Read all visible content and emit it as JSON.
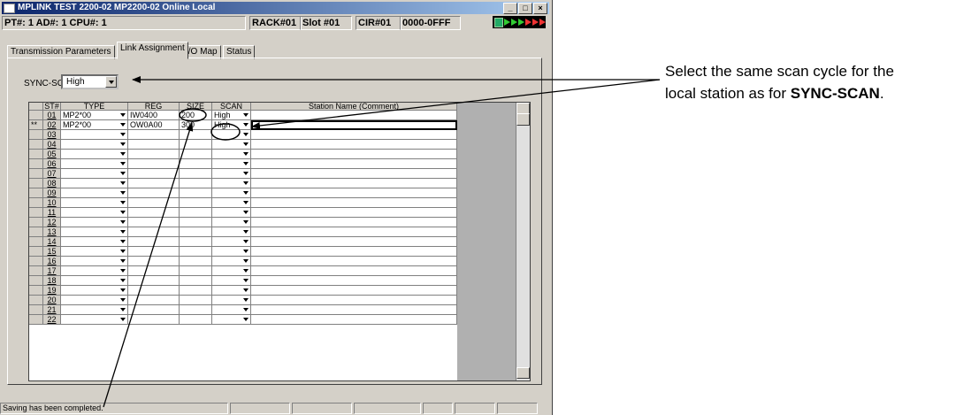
{
  "window": {
    "title": "MPLINK  TEST 2200-02 MP2200-02 Online Local",
    "minimize": "_",
    "maximize": "□",
    "close": "×"
  },
  "infobar": {
    "location": "PT#: 1 AD#: 1 CPU#: 1",
    "rack": "RACK#01",
    "slot": "Slot #01",
    "cir": "CIR#01",
    "range": "0000-0FFF"
  },
  "tabs": [
    "Transmission Parameters",
    "Link Assignment",
    "I/O Map",
    "Status"
  ],
  "sync_scan": {
    "label": "SYNC-SCAN",
    "value": "High"
  },
  "table": {
    "headers": {
      "st": "ST#",
      "type": "TYPE",
      "reg": "REG",
      "size": "SIZE",
      "scan": "SCAN",
      "name": "Station Name (Comment)"
    },
    "rows": [
      {
        "mark": "",
        "st": "01",
        "type": "MP2*00",
        "reg": "IW0400",
        "size": "200",
        "scan": "High",
        "name": ""
      },
      {
        "mark": "**",
        "st": "02",
        "type": "MP2*00",
        "reg": "OW0A00",
        "size": "300",
        "scan": "High",
        "name": ""
      },
      {
        "mark": "",
        "st": "03",
        "type": "",
        "reg": "",
        "size": "",
        "scan": "",
        "name": ""
      },
      {
        "mark": "",
        "st": "04",
        "type": "",
        "reg": "",
        "size": "",
        "scan": "",
        "name": ""
      },
      {
        "mark": "",
        "st": "05",
        "type": "",
        "reg": "",
        "size": "",
        "scan": "",
        "name": ""
      },
      {
        "mark": "",
        "st": "06",
        "type": "",
        "reg": "",
        "size": "",
        "scan": "",
        "name": ""
      },
      {
        "mark": "",
        "st": "07",
        "type": "",
        "reg": "",
        "size": "",
        "scan": "",
        "name": ""
      },
      {
        "mark": "",
        "st": "08",
        "type": "",
        "reg": "",
        "size": "",
        "scan": "",
        "name": ""
      },
      {
        "mark": "",
        "st": "09",
        "type": "",
        "reg": "",
        "size": "",
        "scan": "",
        "name": ""
      },
      {
        "mark": "",
        "st": "10",
        "type": "",
        "reg": "",
        "size": "",
        "scan": "",
        "name": ""
      },
      {
        "mark": "",
        "st": "11",
        "type": "",
        "reg": "",
        "size": "",
        "scan": "",
        "name": ""
      },
      {
        "mark": "",
        "st": "12",
        "type": "",
        "reg": "",
        "size": "",
        "scan": "",
        "name": ""
      },
      {
        "mark": "",
        "st": "13",
        "type": "",
        "reg": "",
        "size": "",
        "scan": "",
        "name": ""
      },
      {
        "mark": "",
        "st": "14",
        "type": "",
        "reg": "",
        "size": "",
        "scan": "",
        "name": ""
      },
      {
        "mark": "",
        "st": "15",
        "type": "",
        "reg": "",
        "size": "",
        "scan": "",
        "name": ""
      },
      {
        "mark": "",
        "st": "16",
        "type": "",
        "reg": "",
        "size": "",
        "scan": "",
        "name": ""
      },
      {
        "mark": "",
        "st": "17",
        "type": "",
        "reg": "",
        "size": "",
        "scan": "",
        "name": ""
      },
      {
        "mark": "",
        "st": "18",
        "type": "",
        "reg": "",
        "size": "",
        "scan": "",
        "name": ""
      },
      {
        "mark": "",
        "st": "19",
        "type": "",
        "reg": "",
        "size": "",
        "scan": "",
        "name": ""
      },
      {
        "mark": "",
        "st": "20",
        "type": "",
        "reg": "",
        "size": "",
        "scan": "",
        "name": ""
      },
      {
        "mark": "",
        "st": "21",
        "type": "",
        "reg": "",
        "size": "",
        "scan": "",
        "name": ""
      },
      {
        "mark": "",
        "st": "22",
        "type": "",
        "reg": "",
        "size": "",
        "scan": "",
        "name": ""
      }
    ]
  },
  "statusbar": {
    "message": "Saving has been completed."
  },
  "callout": {
    "line1": "Select the same scan cycle for the",
    "line2_prefix": "local station as for ",
    "line2_bold": "SYNC-SCAN",
    "line2_suffix": "."
  },
  "colors": {
    "titlebar": "#0a246a",
    "face": "#d4d0c8",
    "annotation": "#000000"
  },
  "icons": [
    "app-icon",
    "connection-status-icon",
    "dropdown-arrow-icon",
    "scroll-up-icon",
    "scroll-down-icon",
    "resize-grip-icon"
  ]
}
